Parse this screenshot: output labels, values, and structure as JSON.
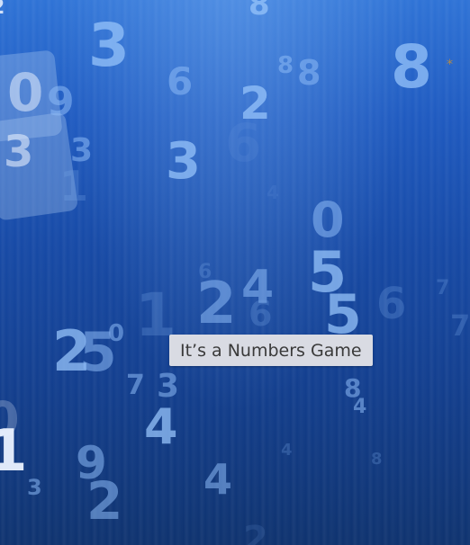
{
  "tooltip": {
    "text": "It’s a Numbers Game"
  },
  "artwork": {
    "digits": [
      "8",
      "3",
      "6",
      "8",
      "8",
      "8",
      "2",
      "0",
      "9",
      "3",
      "3",
      "6",
      "3",
      "1",
      "0",
      "5",
      "6",
      "2",
      "4",
      "6",
      "5",
      "6",
      "7",
      "1",
      "7",
      "2",
      "5",
      "0",
      "3",
      "4",
      "8",
      "4",
      "9",
      "2",
      "3",
      "4",
      "4",
      "7",
      "8",
      "2",
      "0",
      "4",
      "1",
      "2"
    ],
    "sparkle": "*"
  },
  "colors": {
    "background_top": "#2f73d6",
    "background_bottom": "#0f336f",
    "tooltip_bg": "#d9dbe3",
    "tooltip_text": "#3a3a3a"
  }
}
